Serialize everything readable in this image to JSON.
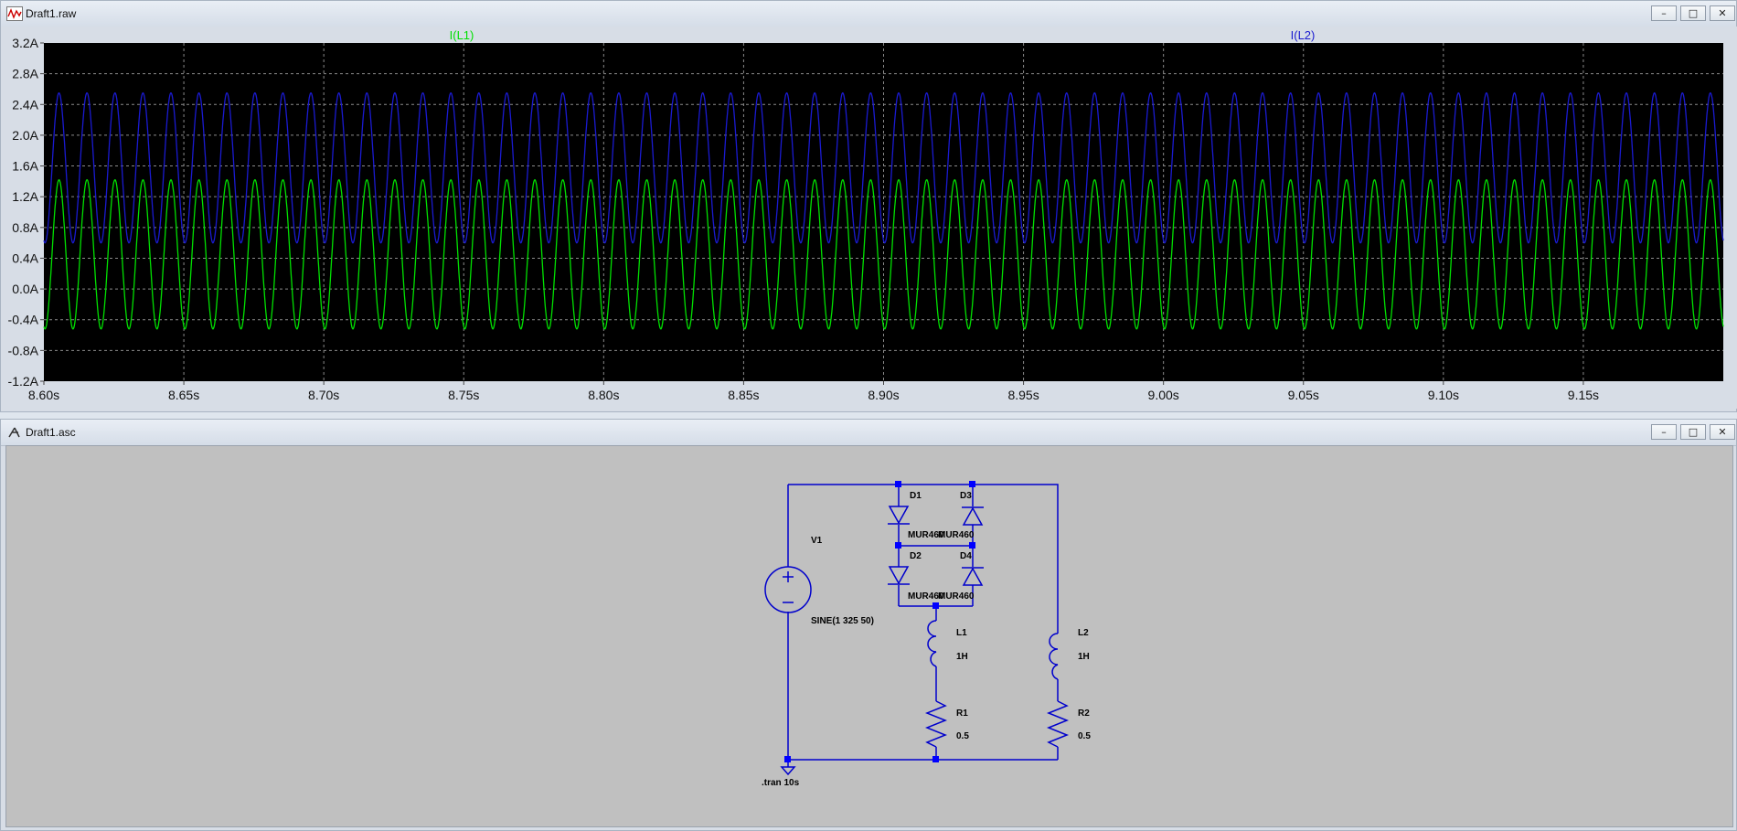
{
  "plot_window": {
    "title": "Draft1.raw",
    "controls": {
      "minimize": "–",
      "maximize": "□",
      "close": "✕"
    }
  },
  "schematic_window": {
    "title": "Draft1.asc",
    "controls": {
      "minimize": "–",
      "maximize": "□",
      "close": "✕"
    }
  },
  "chart_data": {
    "type": "line",
    "title": "",
    "background": "#000000",
    "grid": true,
    "x_range": [
      8.6,
      9.2
    ],
    "ylim": [
      -1.2,
      3.2
    ],
    "x_ticks": [
      "8.60s",
      "8.65s",
      "8.70s",
      "8.75s",
      "8.80s",
      "8.85s",
      "8.90s",
      "8.95s",
      "9.00s",
      "9.05s",
      "9.10s",
      "9.15s"
    ],
    "x_tick_values": [
      8.6,
      8.65,
      8.7,
      8.75,
      8.8,
      8.85,
      8.9,
      8.95,
      9.0,
      9.05,
      9.1,
      9.15
    ],
    "y_ticks": [
      "3.2A",
      "2.8A",
      "2.4A",
      "2.0A",
      "1.6A",
      "1.2A",
      "0.8A",
      "0.4A",
      "0.0A",
      "-0.4A",
      "-0.8A",
      "-1.2A"
    ],
    "y_tick_values": [
      3.2,
      2.8,
      2.4,
      2.0,
      1.6,
      1.2,
      0.8,
      0.4,
      0.0,
      -0.4,
      -0.8,
      -1.2
    ],
    "series": [
      {
        "name": "I(L1)",
        "color": "#00e000",
        "waveform": "sine",
        "frequency_hz": 100,
        "min": -0.52,
        "max": 1.42
      },
      {
        "name": "I(L2)",
        "color": "#1a1ad0",
        "waveform": "sine",
        "frequency_hz": 100,
        "min": 0.6,
        "max": 2.55
      }
    ]
  },
  "schematic": {
    "wire_color": "#0000cc",
    "components": {
      "v1": {
        "ref": "V1",
        "value": "SINE(1 325 50)"
      },
      "d1": {
        "ref": "D1",
        "model": "MUR460"
      },
      "d2": {
        "ref": "D2",
        "model": "MUR460"
      },
      "d3": {
        "ref": "D3",
        "model": "MUR460"
      },
      "d4": {
        "ref": "D4",
        "model": "MUR460"
      },
      "l1": {
        "ref": "L1",
        "value": "1H"
      },
      "l2": {
        "ref": "L2",
        "value": "1H"
      },
      "r1": {
        "ref": "R1",
        "value": "0.5"
      },
      "r2": {
        "ref": "R2",
        "value": "0.5"
      }
    },
    "directive": ".tran 10s"
  }
}
